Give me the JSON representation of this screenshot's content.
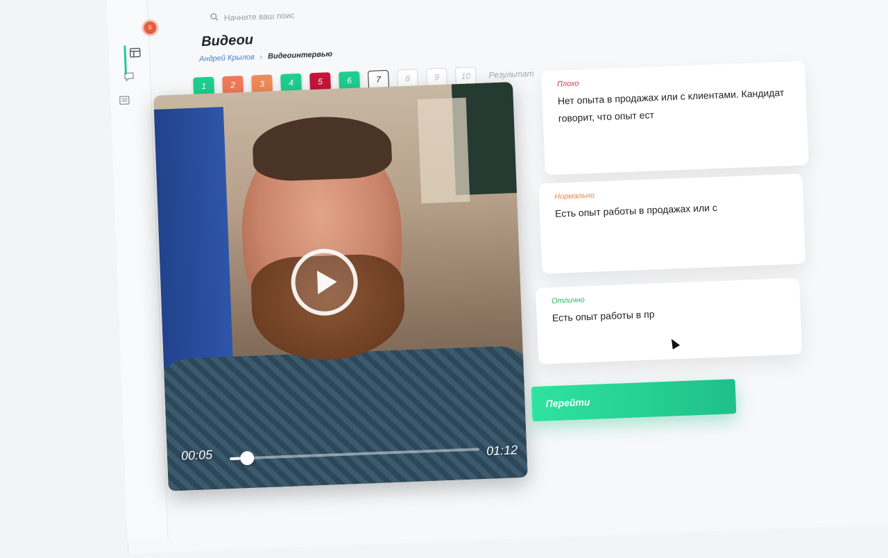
{
  "search": {
    "placeholder": "Начните ваш поис",
    "icon": "search-icon"
  },
  "user": {
    "avatar_letter": "S",
    "avatar_color": "#e95b3f"
  },
  "sidebar": {
    "items": [
      {
        "icon": "layout-icon",
        "active": true
      },
      {
        "icon": "chat-icon",
        "active": false
      },
      {
        "icon": "list-icon",
        "active": false
      }
    ],
    "active_color": "#24c98d"
  },
  "page": {
    "title": "Видеои",
    "breadcrumb": {
      "link": "Андрей Крылов",
      "current": "Видеоинтервью"
    }
  },
  "steps": [
    {
      "label": "1",
      "state": "filled",
      "color": "#1fcf8f"
    },
    {
      "label": "2",
      "state": "filled",
      "color": "#f07a5a"
    },
    {
      "label": "3",
      "state": "filled",
      "color": "#f08a5a"
    },
    {
      "label": "4",
      "state": "filled",
      "color": "#1fcf8f"
    },
    {
      "label": "5",
      "state": "filled",
      "color": "#c4163a"
    },
    {
      "label": "6",
      "state": "filled",
      "color": "#1fcf8f"
    },
    {
      "label": "7",
      "state": "current",
      "color": "#222222"
    },
    {
      "label": "8",
      "state": "empty",
      "color": "#cccccc"
    },
    {
      "label": "9",
      "state": "empty",
      "color": "#cccccc"
    },
    {
      "label": "10",
      "state": "empty",
      "color": "#cccccc"
    }
  ],
  "result_label": "Результат",
  "video": {
    "current_time": "00:05",
    "duration": "01:12",
    "progress": 0.07,
    "play_icon": "play-icon"
  },
  "ratings": [
    {
      "label": "Плохо",
      "label_color": "#d0384f",
      "text": "Нет опыта в продажах или с клиентами. Кандидат говорит, что опыт ест"
    },
    {
      "label": "Нормально",
      "label_color": "#f0883e",
      "text": "Есть опыт работы в продажах или с"
    },
    {
      "label": "Отлично",
      "label_color": "#27b45f",
      "text": "Есть опыт работы в пр"
    }
  ],
  "go_button": {
    "label": "Перейти",
    "color": "#21c98e"
  }
}
